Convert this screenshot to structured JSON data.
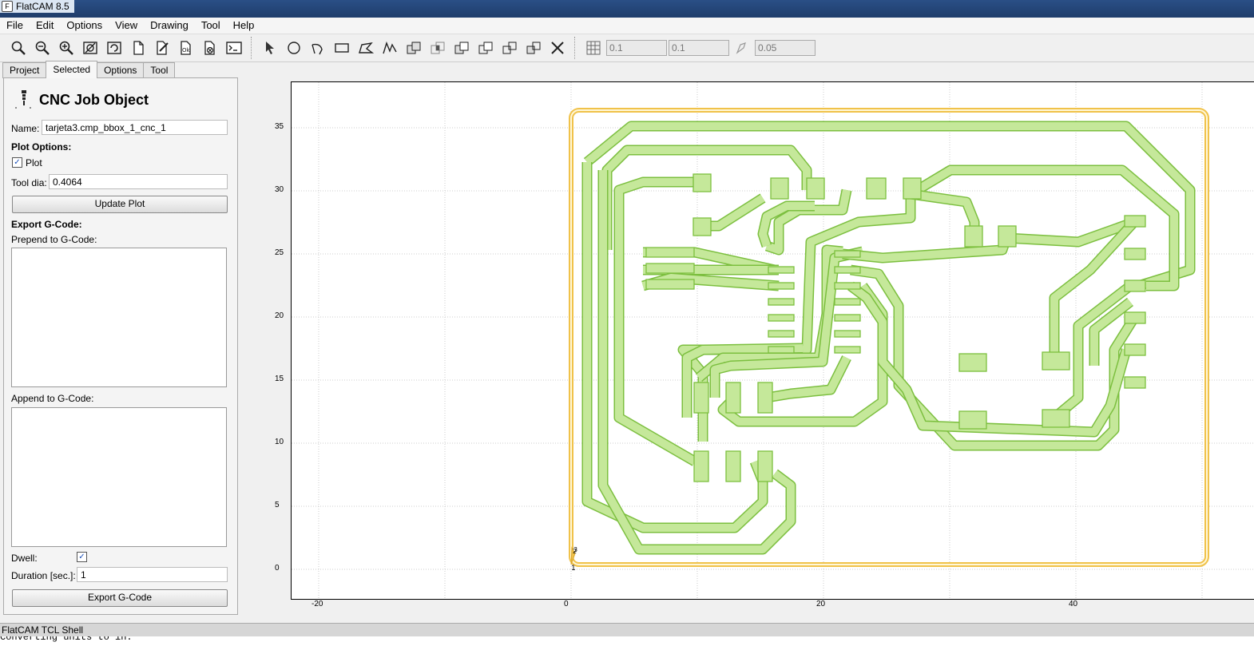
{
  "window": {
    "title": "FlatCAM 8.5"
  },
  "menu": [
    "File",
    "Edit",
    "Options",
    "View",
    "Drawing",
    "Tool",
    "Help"
  ],
  "toolbar": {
    "grid_x": "0.1",
    "grid_y": "0.1",
    "snap_max": "0.05"
  },
  "tabs": [
    "Project",
    "Selected",
    "Options",
    "Tool"
  ],
  "selected_tab": "Selected",
  "panel": {
    "title": "CNC Job Object",
    "name_label": "Name:",
    "name_value": "tarjeta3.cmp_bbox_1_cnc_1",
    "plot_options_label": "Plot Options:",
    "plot_label": "Plot",
    "plot_checked": true,
    "tool_dia_label": "Tool dia:",
    "tool_dia_value": "0.4064",
    "update_plot_label": "Update Plot",
    "export_label": "Export G-Code:",
    "prepend_label": "Prepend to G-Code:",
    "append_label": "Append to G-Code:",
    "dwell_label": "Dwell:",
    "dwell_checked": true,
    "duration_label": "Duration [sec.]:",
    "duration_value": "1",
    "export_button_label": "Export G-Code"
  },
  "plot": {
    "x_ticks": [
      "-20",
      "0",
      "20",
      "40"
    ],
    "y_ticks": [
      "0",
      "5",
      "10",
      "15",
      "20",
      "25",
      "30",
      "35"
    ],
    "markers": [
      "1",
      "2",
      "3"
    ],
    "colors": {
      "trace_fill": "#c5e89a",
      "trace_stroke": "#7cbf3f",
      "outline": "#f0c24a",
      "grid": "#cccccc"
    }
  },
  "shell": {
    "title": "FlatCAM TCL Shell",
    "text": "Converting units to in."
  }
}
